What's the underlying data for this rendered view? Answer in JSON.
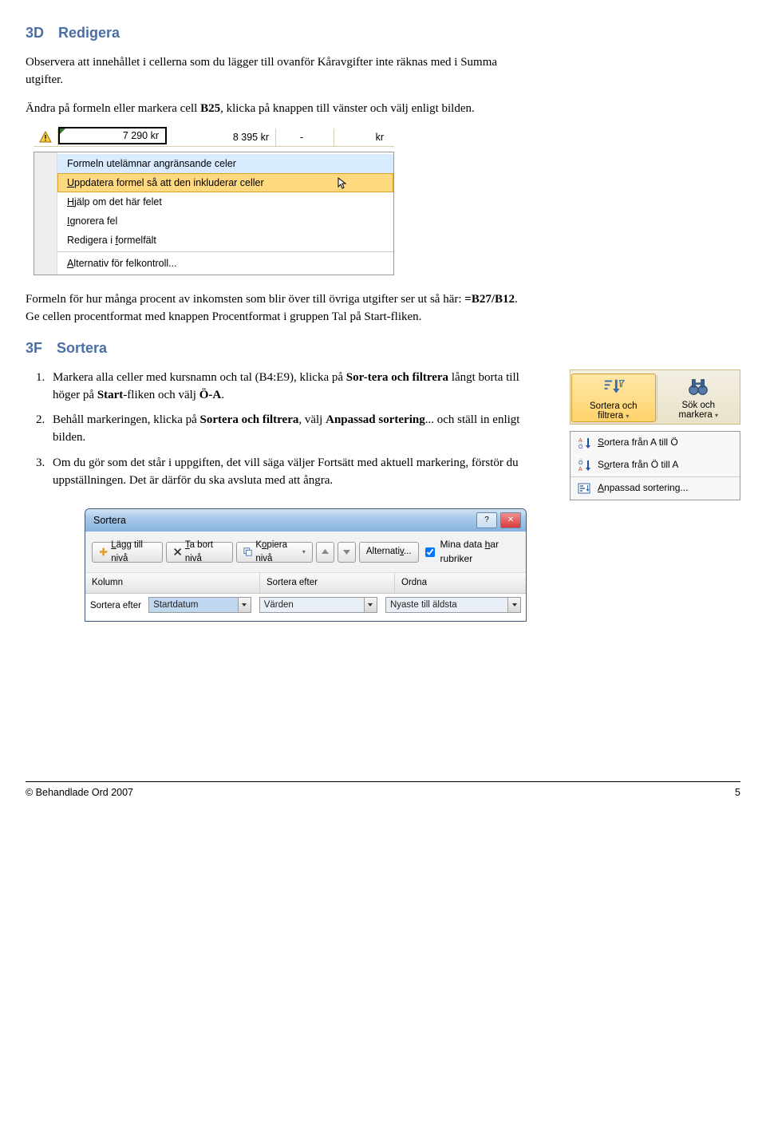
{
  "sec3D": {
    "num": "3D",
    "title": "Redigera",
    "p1a": "Observera att innehållet i cellerna som du lägger till ovanför Kåravgifter inte räknas med i Summa utgifter.",
    "p1b_before": "Ändra på formeln eller markera cell ",
    "p1b_bold": "B25",
    "p1b_after": ", klicka på knappen till vänster och välj enligt bilden.",
    "p2_before": "Formeln för hur många procent av inkomsten som blir över till övriga utgifter ser ut så här: ",
    "p2_bold": "=B27/B12",
    "p2_after": ". Ge cellen procentformat med knappen Procentformat i gruppen Tal på Start-fliken."
  },
  "ss1": {
    "cells": {
      "sel": "7 290 kr",
      "c2": "8 395 kr",
      "c3": "-",
      "c4": "kr"
    },
    "menu": {
      "title": "Formeln utelämnar angränsande celer",
      "item_update_pre": "",
      "item_update_u": "U",
      "item_update_post": "ppdatera formel så att den inkluderar celler",
      "item_help_u": "H",
      "item_help_post": "jälp om det här felet",
      "item_ignore_u": "I",
      "item_ignore_post": "gnorera fel",
      "item_edit_pre": "Redigera i ",
      "item_edit_u": "f",
      "item_edit_post": "ormelfält",
      "item_alt_u": "A",
      "item_alt_post": "lternativ för felkontroll..."
    }
  },
  "sec3F": {
    "num": "3F",
    "title": "Sortera",
    "li1_before": "Markera alla celler med kursnamn och tal (B4:E9), klicka på ",
    "li1_sort": "Sor-tera och filtrera",
    "li1_mid": " långt borta till höger på ",
    "li1_start": "Start",
    "li1_after": "-fliken och välj ",
    "li1_oa": "Ö-A",
    "li1_end": ".",
    "li2_before": "Behåll markeringen, klicka på ",
    "li2_sort": "Sortera och filtrera",
    "li2_mid": ", välj ",
    "li2_anp": "Anpassad sortering",
    "li2_after": "... och ställ in enligt bilden.",
    "li3": "Om du gör som det står i uppgiften, det vill säga väljer Fortsätt med aktuell markering, förstör du uppställningen. Det är därför du ska avsluta med att ångra."
  },
  "ss2": {
    "btn1_l1": "Sortera och",
    "btn1_l2": "filtrera",
    "btn2_l1": "Sök och",
    "btn2_l2": "markera"
  },
  "ss3": {
    "item1_u": "S",
    "item1_post": "ortera från A till Ö",
    "item2_pre": "S",
    "item2_u": "o",
    "item2_post": "rtera från Ö till A",
    "item3_u": "A",
    "item3_post": "npassad sortering..."
  },
  "ss4": {
    "title": "Sortera",
    "btn_add_pre": "",
    "btn_add_u": "L",
    "btn_add_post": "ägg till nivå",
    "btn_del_u": "T",
    "btn_del_post": "a bort nivå",
    "btn_copy_pre": "K",
    "btn_copy_u": "o",
    "btn_copy_post": "piera nivå",
    "btn_opt_pre": "Alternati",
    "btn_opt_u": "v",
    "btn_opt_post": "...",
    "chk_pre": "Mina data ",
    "chk_u": "h",
    "chk_post": "ar rubriker",
    "head_col": "Kolumn",
    "head_sort": "Sortera efter",
    "head_ordna": "Ordna",
    "row_label": "Sortera efter",
    "combo1": "Startdatum",
    "combo2": "Värden",
    "combo3": "Nyaste till äldsta"
  },
  "footer": {
    "left": "© Behandlade Ord 2007",
    "right": "5"
  }
}
